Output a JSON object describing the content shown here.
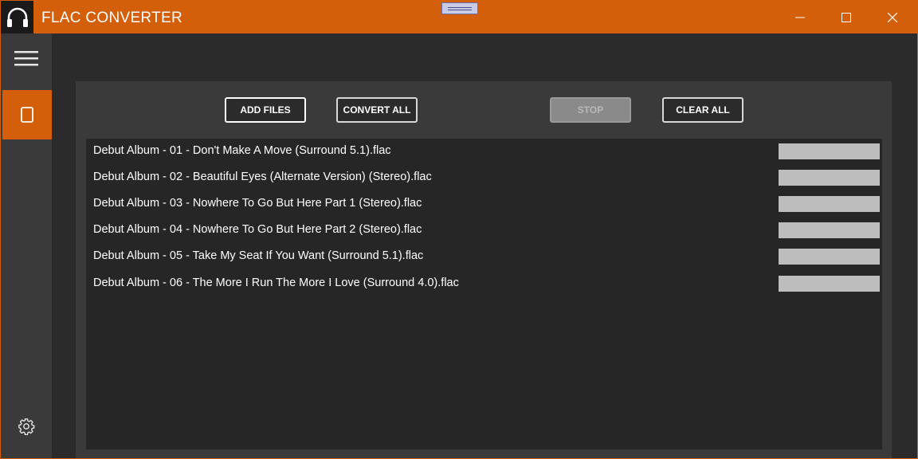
{
  "window": {
    "title": "FLAC CONVERTER"
  },
  "toolbar": {
    "add_files": "ADD FILES",
    "convert_all": "CONVERT ALL",
    "stop": "STOP",
    "clear_all": "CLEAR ALL"
  },
  "files": [
    {
      "name": "Debut Album - 01 - Don't Make A Move (Surround 5.1).flac",
      "progress": 0
    },
    {
      "name": "Debut Album - 02 - Beautiful Eyes (Alternate Version) (Stereo).flac",
      "progress": 0
    },
    {
      "name": "Debut Album - 03 - Nowhere To Go But Here Part 1 (Stereo).flac",
      "progress": 0
    },
    {
      "name": "Debut Album - 04 - Nowhere To Go But Here Part 2 (Stereo).flac",
      "progress": 0
    },
    {
      "name": "Debut Album - 05 - Take My Seat If You Want (Surround 5.1).flac",
      "progress": 0
    },
    {
      "name": "Debut Album - 06 - The More I Run The More I Love (Surround 4.0).flac",
      "progress": 0
    }
  ],
  "icons": {
    "app": "headphones-icon",
    "menu": "hamburger-icon",
    "nav_converter": "document-icon",
    "settings": "gear-icon",
    "minimize": "minimize-icon",
    "maximize": "maximize-icon",
    "close": "close-icon"
  },
  "colors": {
    "accent": "#d35f0a",
    "background": "#2b2b2b",
    "panel": "#3a3a3a",
    "list": "#262626",
    "progress_track": "#bdbdbd"
  }
}
